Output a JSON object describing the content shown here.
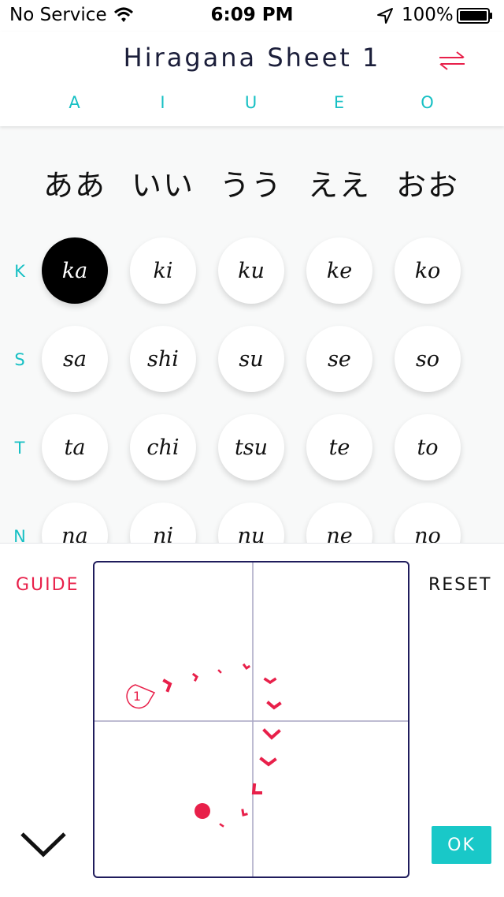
{
  "status_bar": {
    "carrier": "No Service",
    "time": "6:09 PM",
    "battery": "100%"
  },
  "header": {
    "title": "Hiragana Sheet 1",
    "vowels": [
      "A",
      "I",
      "U",
      "E",
      "O"
    ]
  },
  "kana_header": [
    "ああ",
    "いい",
    "うう",
    "ええ",
    "おお"
  ],
  "rows": [
    {
      "label": "K",
      "syllables": [
        "ka",
        "ki",
        "ku",
        "ke",
        "ko"
      ]
    },
    {
      "label": "S",
      "syllables": [
        "sa",
        "shi",
        "su",
        "se",
        "so"
      ]
    },
    {
      "label": "T",
      "syllables": [
        "ta",
        "chi",
        "tsu",
        "te",
        "to"
      ]
    },
    {
      "label": "N",
      "syllables": [
        "na",
        "ni",
        "nu",
        "ne",
        "no"
      ]
    }
  ],
  "selected": "ka",
  "panel": {
    "guide_label": "GUIDE",
    "reset_label": "RESET",
    "ok_label": "OK",
    "stroke_number": "1"
  },
  "colors": {
    "accent_teal": "#17c0c4",
    "accent_red": "#e8204a",
    "title_navy": "#1b1e3a"
  },
  "icons": {
    "swap": "swap-arrows-icon",
    "collapse": "chevron-down-icon",
    "wifi": "wifi-icon",
    "location": "location-arrow-icon",
    "battery": "battery-icon"
  }
}
